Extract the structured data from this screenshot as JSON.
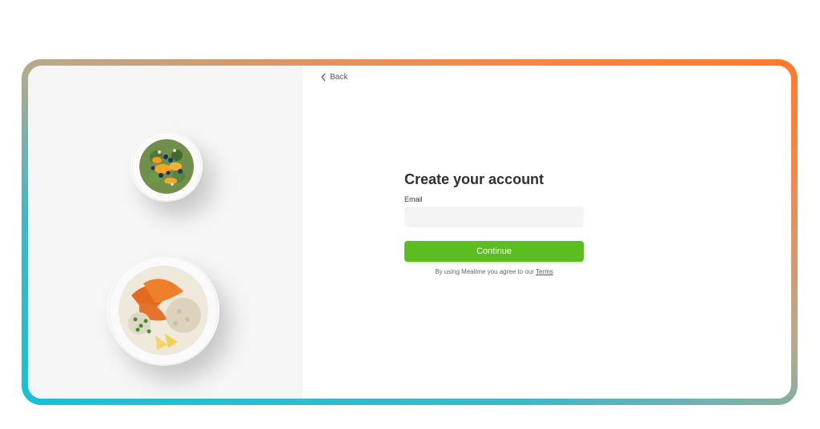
{
  "back": {
    "label": "Back",
    "icon": "chevron-left-icon"
  },
  "form": {
    "title": "Create your account",
    "email_label": "Email",
    "email_value": "",
    "email_placeholder": "",
    "continue_label": "Continue",
    "terms_text": "By using Mealime you agree to our",
    "terms_link": "Terms"
  },
  "colors": {
    "accent": "#5bbd1f",
    "frame_gradient_start": "#17c0d6",
    "frame_gradient_end": "#ff7a2a",
    "left_panel": "#f5f5f5"
  }
}
